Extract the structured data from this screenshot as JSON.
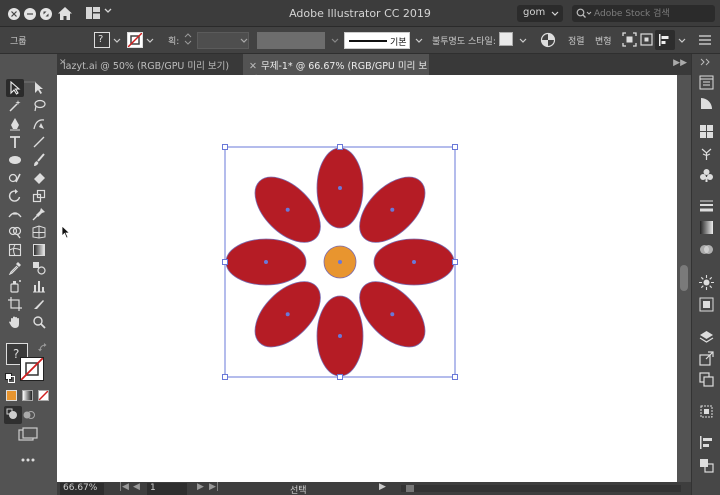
{
  "window": {
    "title": "Adobe Illustrator CC 2019"
  },
  "titlebar": {
    "user": "gom",
    "stock_search_placeholder": "Adobe Stock 검색"
  },
  "control": {
    "selection_label": "그룹",
    "stroke_label": "획:",
    "stroke_profile_label": "기본",
    "opacity_label": "불투명도",
    "style_label": "스타일:",
    "align_label": "정렬",
    "transform_label": "변형"
  },
  "tabs": [
    {
      "label": "lazyt.ai @ 50% (RGB/GPU 미리 보기)",
      "active": false
    },
    {
      "label": "무제-1* @ 66.67% (RGB/GPU 미리 보기)",
      "active": true
    }
  ],
  "status": {
    "zoom": "66.67%",
    "page": "1",
    "tool": "선택"
  },
  "colors": {
    "petal": "#b51c25",
    "center": "#e8952f",
    "selection": "#6a78d8"
  },
  "icons": {
    "home": "home-icon",
    "workspace": "workspace-grid-icon",
    "search": "search-icon"
  }
}
